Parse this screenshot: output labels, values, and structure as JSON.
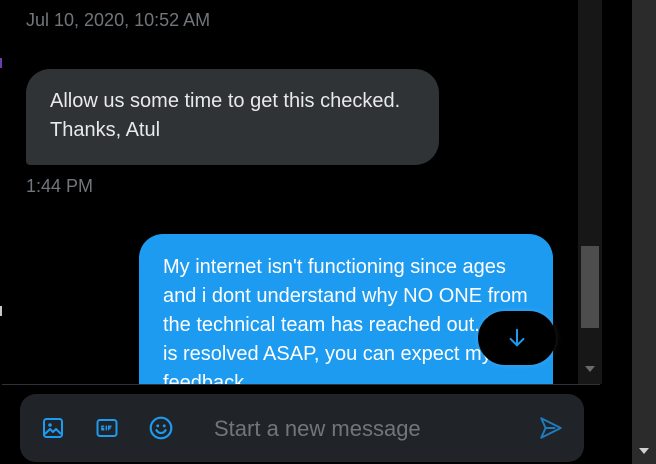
{
  "conversation": {
    "date_stamp": "Jul 10, 2020, 10:52 AM",
    "received_message": "Allow us some time to get this checked. Thanks, Atul",
    "received_time": "1:44 PM",
    "sent_message": "My internet isn't functioning since ages and i dont understand why NO ONE from the technical team has reached out. If it is resolved ASAP, you can expect my feedback"
  },
  "composer": {
    "placeholder": "Start a new message",
    "icons": [
      "image-icon",
      "gif-icon",
      "emoji-icon",
      "send-icon"
    ]
  },
  "colors": {
    "accent": "#1d9bf0",
    "received_bubble": "#2f3336",
    "composer_bg": "#202327",
    "muted_text": "#71767b"
  }
}
